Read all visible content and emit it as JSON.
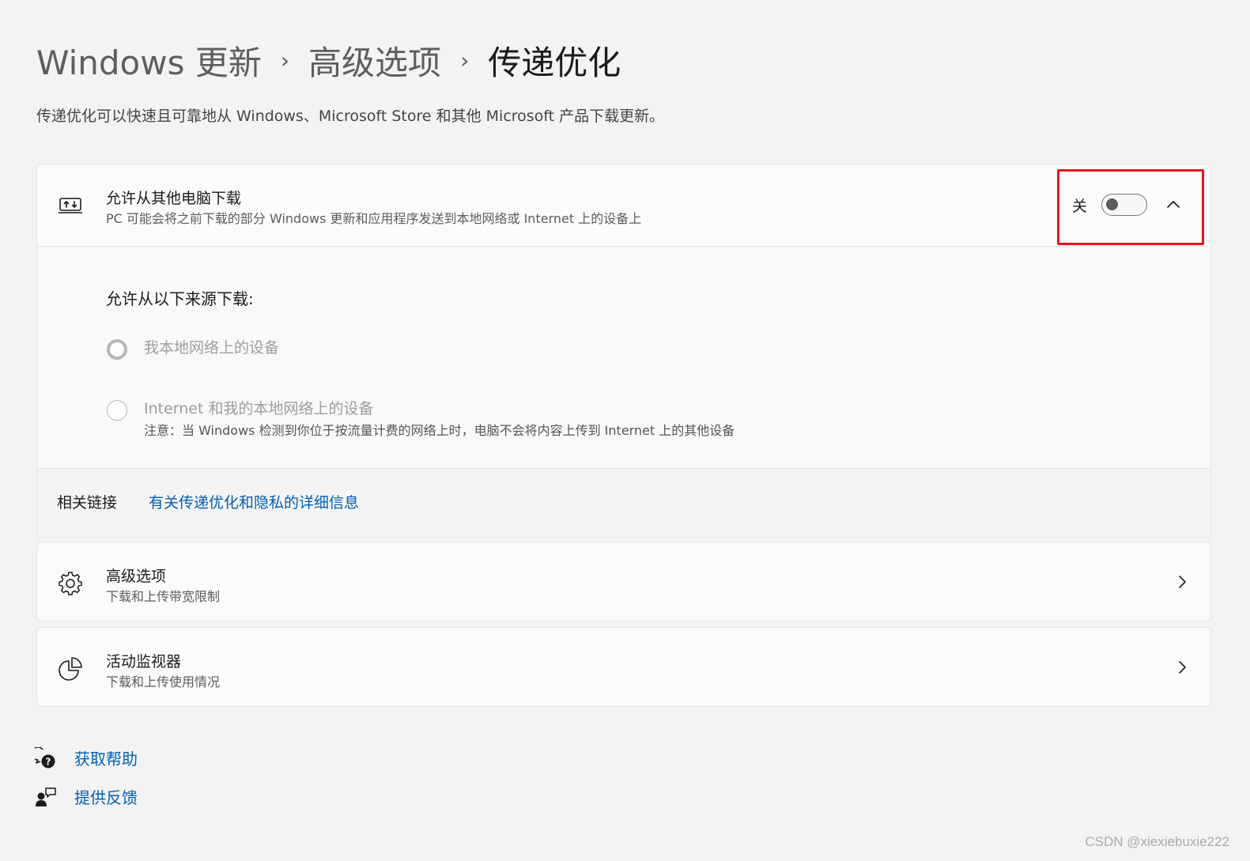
{
  "breadcrumb": {
    "items": [
      "Windows 更新",
      "高级选项"
    ],
    "current": "传递优化",
    "separator": "›"
  },
  "description": "传递优化可以快速且可靠地从 Windows、Microsoft Store 和其他 Microsoft 产品下载更新。",
  "allow_downloads": {
    "icon": "laptop-transfer-icon",
    "title": "允许从其他电脑下载",
    "subtitle": "PC 可能会将之前下载的部分 Windows 更新和应用程序发送到本地网络或 Internet 上的设备上",
    "toggle_label": "关",
    "toggle_on": false,
    "expanded": true,
    "sources_label": "允许从以下来源下载:",
    "options": [
      {
        "label": "我本地网络上的设备",
        "selected": true
      },
      {
        "label": "Internet 和我的本地网络上的设备",
        "selected": false,
        "note": "注意：当 Windows 检测到你位于按流量计费的网络上时，电脑不会将内容上传到 Internet 上的其他设备"
      }
    ]
  },
  "related": {
    "label": "相关链接",
    "link": "有关传递优化和隐私的详细信息"
  },
  "advanced": {
    "icon": "gear-icon",
    "title": "高级选项",
    "subtitle": "下载和上传带宽限制"
  },
  "monitor": {
    "icon": "pie-chart-icon",
    "title": "活动监视器",
    "subtitle": "下载和上传使用情况"
  },
  "footer": {
    "help": "获取帮助",
    "feedback": "提供反馈"
  },
  "watermark": "CSDN @xiexiebuxie222",
  "colors": {
    "accent": "#005fb8",
    "highlight": "#e8141b",
    "background": "#f3f3f3"
  }
}
